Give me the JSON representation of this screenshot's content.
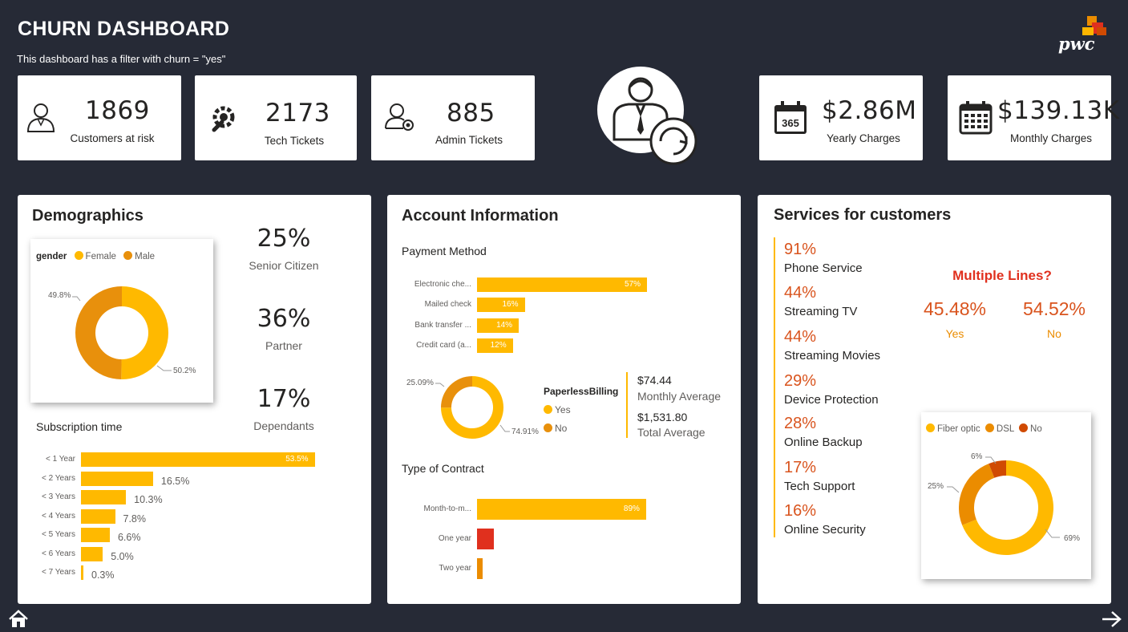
{
  "header": {
    "title": "CHURN DASHBOARD",
    "subtitle": "This dashboard has a filter with churn = \"yes\"",
    "logo_text": "pwc"
  },
  "kpis": [
    {
      "value": "1869",
      "label": "Customers at risk",
      "icon": "person-icon"
    },
    {
      "value": "2173",
      "label": "Tech Tickets",
      "icon": "gear-wrench-icon"
    },
    {
      "value": "885",
      "label": "Admin Tickets",
      "icon": "user-star-icon"
    },
    {
      "value": "$2.86M",
      "label": "Yearly Charges",
      "icon": "calendar-365-icon"
    },
    {
      "value": "$139.13K",
      "label": "Monthly Charges",
      "icon": "calendar-grid-icon"
    }
  ],
  "demographics": {
    "title": "Demographics",
    "gender_chart": {
      "legend_title": "gender",
      "legend": [
        "Female",
        "Male"
      ],
      "label_male": "49.8%",
      "label_female": "50.2%"
    },
    "stats": [
      {
        "value": "25%",
        "label": "Senior Citizen"
      },
      {
        "value": "36%",
        "label": "Partner"
      },
      {
        "value": "17%",
        "label": "Dependants"
      }
    ],
    "subscription_title": "Subscription time"
  },
  "account": {
    "title": "Account Information",
    "payment_title": "Payment Method",
    "paperless": {
      "legend_title": "PaperlessBilling",
      "legend": [
        "Yes",
        "No"
      ],
      "label_no": "25.09%",
      "label_yes": "74.91%"
    },
    "monthly_avg_value": "$74.44",
    "monthly_avg_label": "Monthly Average",
    "total_avg_value": "$1,531.80",
    "total_avg_label": "Total Average",
    "contract_title": "Type of Contract"
  },
  "services": {
    "title": "Services for customers",
    "items": [
      {
        "pct": "91%",
        "label": "Phone Service"
      },
      {
        "pct": "44%",
        "label": "Streaming TV"
      },
      {
        "pct": "44%",
        "label": "Streaming Movies"
      },
      {
        "pct": "29%",
        "label": "Device Protection"
      },
      {
        "pct": "28%",
        "label": "Online Backup"
      },
      {
        "pct": "17%",
        "label": "Tech Support"
      },
      {
        "pct": "16%",
        "label": "Online Security"
      }
    ],
    "multiple_lines": {
      "title": "Multiple Lines?",
      "yes_value": "45.48%",
      "yes_label": "Yes",
      "no_value": "54.52%",
      "no_label": "No"
    },
    "internet": {
      "legend": [
        "Fiber optic",
        "DSL",
        "No"
      ],
      "label_fiber": "69%",
      "label_dsl": "25%",
      "label_no": "6%"
    }
  },
  "nav": {
    "home_icon": "home-icon",
    "next_icon": "arrow-right-icon"
  },
  "colors": {
    "background": "#262a36",
    "bar": "#ffb900",
    "male": "#e8900c",
    "accent_red": "#d9541e",
    "contract_one_year": "#e0301e",
    "contract_two_year": "#eb8c00",
    "internet_no": "#d04a02"
  },
  "chart_data": [
    {
      "type": "pie",
      "title": "gender",
      "categories": [
        "Female",
        "Male"
      ],
      "values": [
        50.2,
        49.8
      ],
      "colors": [
        "#ffb900",
        "#e8900c"
      ],
      "donut": true
    },
    {
      "type": "bar",
      "title": "Subscription time",
      "orientation": "horizontal",
      "categories": [
        "< 1 Year",
        "< 2 Years",
        "< 3 Years",
        "< 4 Years",
        "< 5 Years",
        "< 6 Years",
        "< 7 Years"
      ],
      "values": [
        53.5,
        16.5,
        10.3,
        7.8,
        6.6,
        5.0,
        0.3
      ],
      "labels": [
        "53.5%",
        "16.5%",
        "10.3%",
        "7.8%",
        "6.6%",
        "5.0%",
        "0.3%"
      ]
    },
    {
      "type": "bar",
      "title": "Payment Method",
      "orientation": "horizontal",
      "categories": [
        "Electronic che...",
        "Mailed check",
        "Bank transfer ...",
        "Credit card (a..."
      ],
      "values": [
        57,
        16,
        14,
        12
      ],
      "labels": [
        "57%",
        "16%",
        "14%",
        "12%"
      ]
    },
    {
      "type": "pie",
      "title": "PaperlessBilling",
      "categories": [
        "Yes",
        "No"
      ],
      "values": [
        74.91,
        25.09
      ],
      "colors": [
        "#ffb900",
        "#e8900c"
      ],
      "donut": true
    },
    {
      "type": "bar",
      "title": "Type of Contract",
      "orientation": "horizontal",
      "categories": [
        "Month-to-m...",
        "One year",
        "Two year"
      ],
      "values": [
        89,
        9,
        3
      ],
      "labels": [
        "89%",
        "",
        ""
      ],
      "colors": [
        "#ffb900",
        "#e0301e",
        "#eb8c00"
      ]
    },
    {
      "type": "pie",
      "title": "",
      "categories": [
        "Fiber optic",
        "DSL",
        "No"
      ],
      "values": [
        69,
        25,
        6
      ],
      "colors": [
        "#ffb900",
        "#eb8c00",
        "#d04a02"
      ],
      "donut": true
    }
  ]
}
